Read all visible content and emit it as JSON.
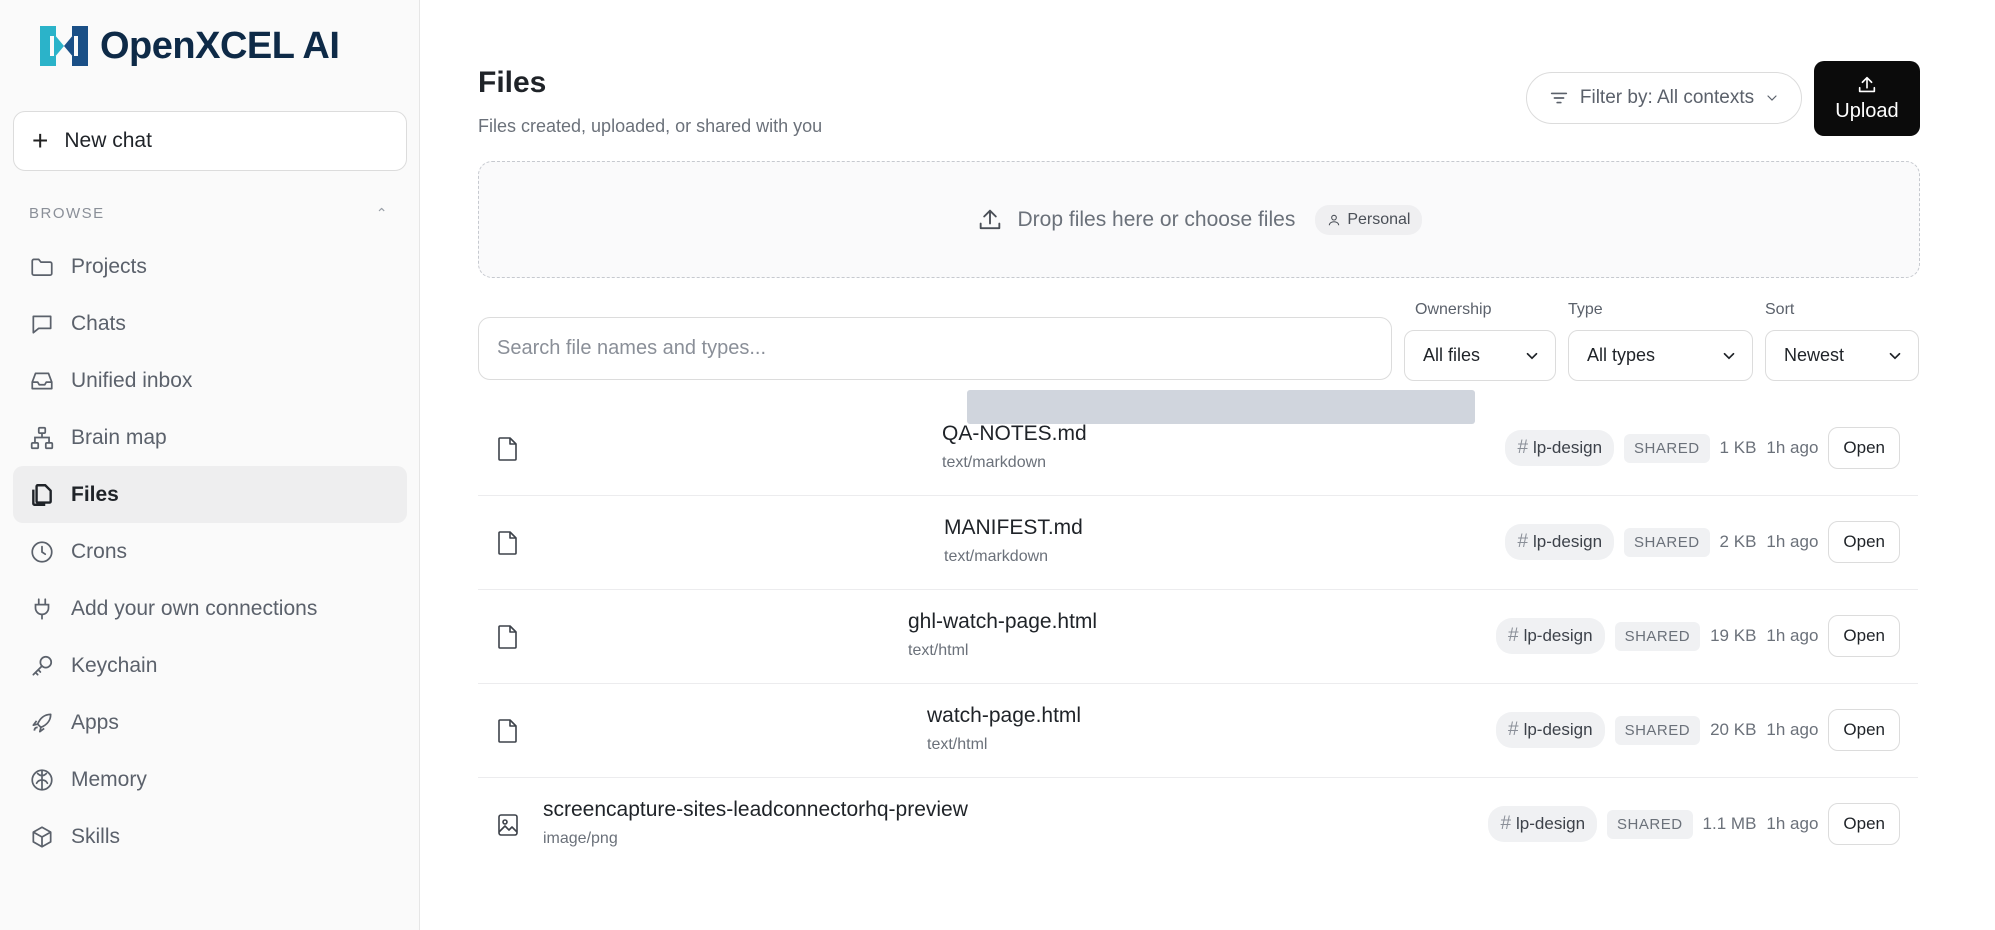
{
  "app": {
    "name": "OpenXCEL AI"
  },
  "sidebar": {
    "new_chat_label": "New chat",
    "browse_label": "BROWSE",
    "items": [
      {
        "label": "Projects",
        "icon": "folder-icon"
      },
      {
        "label": "Chats",
        "icon": "chat-icon"
      },
      {
        "label": "Unified inbox",
        "icon": "inbox-icon"
      },
      {
        "label": "Brain map",
        "icon": "hierarchy-icon"
      },
      {
        "label": "Files",
        "icon": "files-icon",
        "active": true
      },
      {
        "label": "Crons",
        "icon": "clock-icon"
      },
      {
        "label": "Add your own connections",
        "icon": "plug-icon"
      },
      {
        "label": "Keychain",
        "icon": "key-icon"
      },
      {
        "label": "Apps",
        "icon": "rocket-icon"
      },
      {
        "label": "Memory",
        "icon": "brain-icon"
      },
      {
        "label": "Skills",
        "icon": "cube-icon"
      }
    ]
  },
  "main": {
    "title": "Files",
    "subtitle": "Files created, uploaded, or shared with you",
    "filter_label": "Filter by: All contexts",
    "upload_label": "Upload",
    "dropzone": {
      "text": "Drop files here or choose files",
      "scope": "Personal"
    },
    "search_placeholder": "Search file names and types...",
    "filters": {
      "ownership": {
        "label": "Ownership",
        "value": "All files"
      },
      "type": {
        "label": "Type",
        "value": "All types"
      },
      "sort": {
        "label": "Sort",
        "value": "Newest"
      }
    },
    "open_label": "Open",
    "files": [
      {
        "name": "QA-NOTES.md",
        "type": "text/markdown",
        "tag": "lp-design",
        "status": "SHARED",
        "size": "1 KB",
        "age": "1h ago",
        "icon": "file-icon"
      },
      {
        "name": "MANIFEST.md",
        "type": "text/markdown",
        "tag": "lp-design",
        "status": "SHARED",
        "size": "2 KB",
        "age": "1h ago",
        "icon": "file-icon"
      },
      {
        "name": "ghl-watch-page.html",
        "type": "text/html",
        "tag": "lp-design",
        "status": "SHARED",
        "size": "19 KB",
        "age": "1h ago",
        "icon": "file-icon"
      },
      {
        "name": "watch-page.html",
        "type": "text/html",
        "tag": "lp-design",
        "status": "SHARED",
        "size": "20 KB",
        "age": "1h ago",
        "icon": "file-icon"
      },
      {
        "name": "screencapture-sites-leadconnectorhq-preview",
        "type": "image/png",
        "tag": "lp-design",
        "status": "SHARED",
        "size": "1.1 MB",
        "age": "1h ago",
        "icon": "image-icon"
      }
    ]
  }
}
